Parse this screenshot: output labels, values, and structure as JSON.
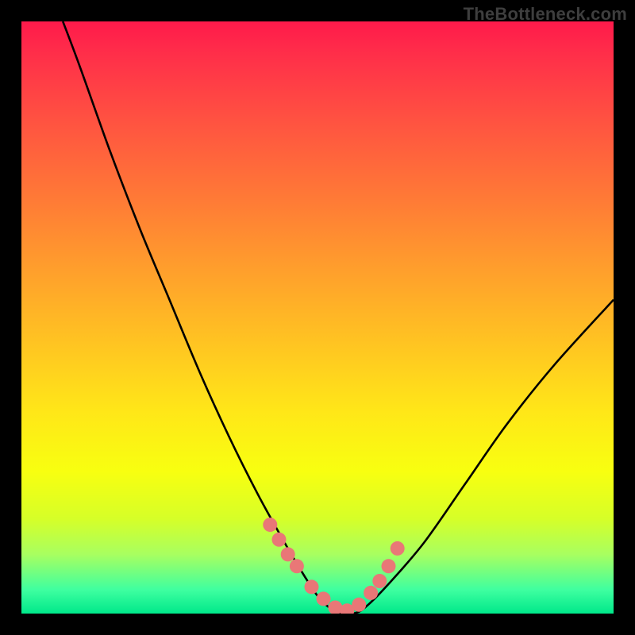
{
  "watermark": "TheBottleneck.com",
  "colors": {
    "frame_bg": "#000000",
    "curve": "#000000",
    "marker": "#e97777",
    "gradient_stops": [
      "#ff1a4b",
      "#ff3049",
      "#ff5640",
      "#ff7a36",
      "#ff9f2c",
      "#ffc322",
      "#ffe718",
      "#f8ff10",
      "#d6ff28",
      "#a8ff60",
      "#3effa0",
      "#00e88a"
    ]
  },
  "chart_data": {
    "type": "line",
    "title": "",
    "xlabel": "",
    "ylabel": "",
    "xlim": [
      0,
      100
    ],
    "ylim": [
      0,
      100
    ],
    "series": [
      {
        "name": "bottleneck-curve",
        "x": [
          7,
          10,
          15,
          20,
          25,
          30,
          35,
          40,
          45,
          48,
          50,
          52,
          54,
          56,
          58,
          62,
          68,
          75,
          82,
          90,
          100
        ],
        "y": [
          100,
          92,
          78,
          65,
          53,
          41,
          30,
          20,
          11,
          6,
          3,
          1,
          0,
          0,
          1,
          5,
          12,
          22,
          32,
          42,
          53
        ]
      }
    ],
    "markers": {
      "name": "highlight-dots",
      "x": [
        42,
        43.5,
        45,
        46.5,
        49,
        51,
        53,
        55,
        57,
        59,
        60.5,
        62,
        63.5
      ],
      "y": [
        15,
        12.5,
        10,
        8,
        4.5,
        2.5,
        1,
        0.5,
        1.5,
        3.5,
        5.5,
        8,
        11
      ]
    }
  }
}
